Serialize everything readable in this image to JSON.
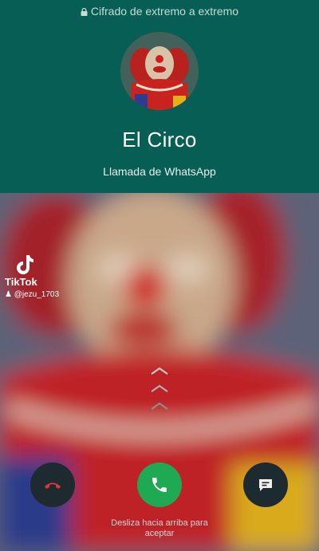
{
  "header": {
    "encryption_text": "Cifrado de extremo a extremo",
    "contact_name": "El Circo",
    "call_type": "Llamada de WhatsApp"
  },
  "watermark": {
    "app_name": "TikTok",
    "username": "@jezu_1703"
  },
  "controls": {
    "decline_icon": "phone-hangup-icon",
    "accept_icon": "phone-icon",
    "message_icon": "message-icon",
    "hint": "Desliza hacia arriba para aceptar"
  },
  "colors": {
    "header_bg": "#075e54",
    "accept_green": "#1ea952",
    "decline_red": "#e0363b"
  }
}
